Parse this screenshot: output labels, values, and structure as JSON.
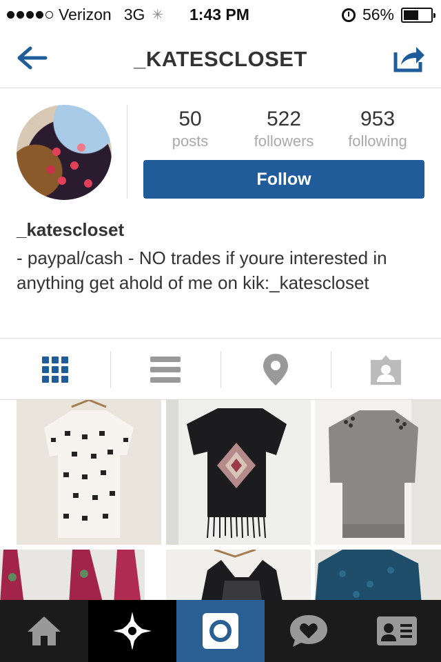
{
  "status_bar": {
    "carrier": "Verizon",
    "network": "3G",
    "time": "1:43 PM",
    "battery": "56%",
    "battery_level": 0.56
  },
  "nav": {
    "title": "_KATESCLOSET",
    "back_icon": "back-arrow-icon",
    "share_icon": "share-icon"
  },
  "profile": {
    "stats": [
      {
        "value": "50",
        "label": "posts"
      },
      {
        "value": "522",
        "label": "followers"
      },
      {
        "value": "953",
        "label": "following"
      }
    ],
    "follow_label": "Follow",
    "username": "_katescloset",
    "bio": "- paypal/cash - NO trades if youre interested in anything get ahold of me on kik:_katescloset",
    "accent": "#1f5c99"
  },
  "view_tabs": [
    {
      "icon": "grid-view-icon",
      "active": true
    },
    {
      "icon": "list-view-icon",
      "active": false
    },
    {
      "icon": "location-pin-icon",
      "active": false
    },
    {
      "icon": "tagged-photos-icon",
      "active": false
    }
  ],
  "tab_bar": [
    {
      "icon": "home-icon",
      "active": false
    },
    {
      "icon": "explore-star-icon",
      "active": false
    },
    {
      "icon": "camera-icon",
      "active": true
    },
    {
      "icon": "activity-heart-icon",
      "active": false
    },
    {
      "icon": "profile-card-icon",
      "active": false
    }
  ]
}
